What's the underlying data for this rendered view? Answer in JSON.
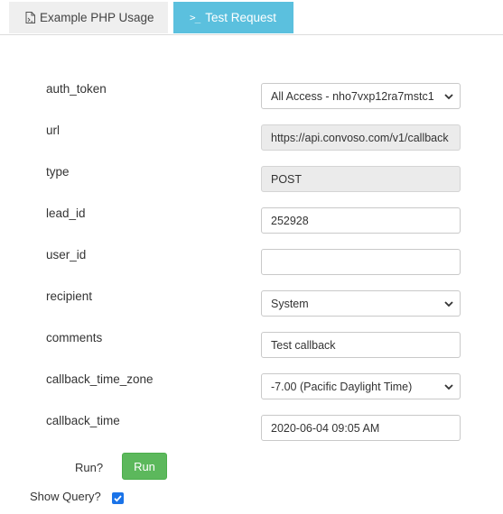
{
  "tabs": {
    "php": {
      "label": "Example PHP Usage",
      "icon": "php-file-icon"
    },
    "test": {
      "label": "Test Request",
      "icon": "terminal-icon"
    }
  },
  "form": {
    "auth_token": {
      "label": "auth_token",
      "value": "All Access - nho7vxp12ra7mstc1"
    },
    "url": {
      "label": "url",
      "value": "https://api.convoso.com/v1/callback"
    },
    "type": {
      "label": "type",
      "value": "POST"
    },
    "lead_id": {
      "label": "lead_id",
      "value": "252928"
    },
    "user_id": {
      "label": "user_id",
      "value": ""
    },
    "recipient": {
      "label": "recipient",
      "value": "System"
    },
    "comments": {
      "label": "comments",
      "value": "Test callback"
    },
    "callback_time_zone": {
      "label": "callback_time_zone",
      "value": "-7.00 (Pacific Daylight Time)"
    },
    "callback_time": {
      "label": "callback_time",
      "value": "2020-06-04 09:05 AM"
    }
  },
  "run": {
    "label": "Run?",
    "button": "Run"
  },
  "show_query": {
    "label": "Show Query?",
    "checked": true
  },
  "colors": {
    "active_tab": "#5bc0de",
    "run_button": "#5cb85c",
    "checkbox": "#1a73e8"
  }
}
